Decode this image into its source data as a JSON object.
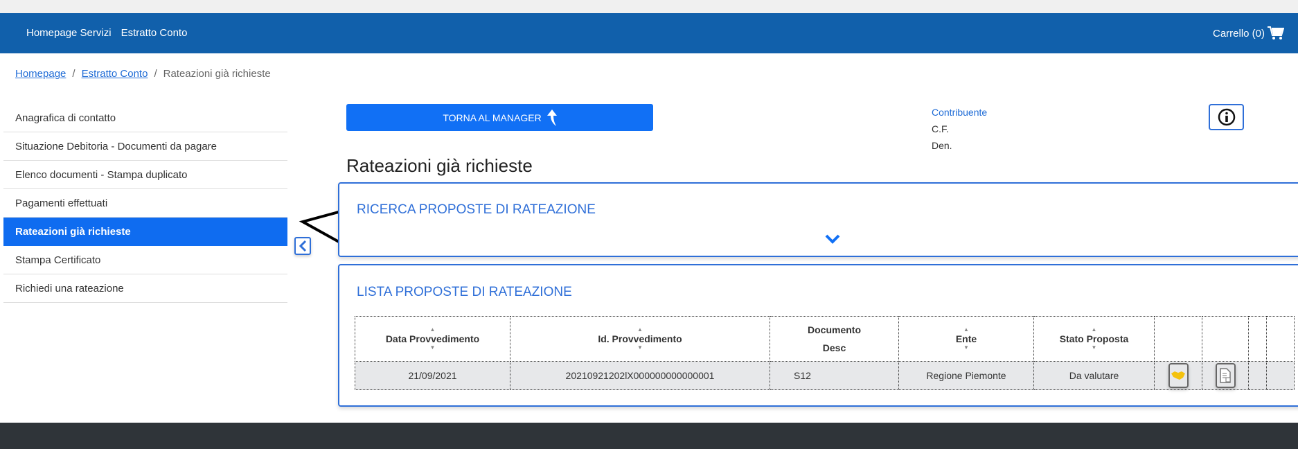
{
  "header": {
    "nav": [
      "Homepage Servizi",
      "Estratto Conto"
    ],
    "cart_label": "Carrello (0)"
  },
  "breadcrumb": {
    "items": [
      "Homepage",
      "Estratto Conto"
    ],
    "current": "Rateazioni già richieste"
  },
  "sidebar": {
    "items": [
      "Anagrafica di contatto",
      "Situazione Debitoria - Documenti da pagare",
      "Elenco documenti - Stampa duplicato",
      "Pagamenti effettuati",
      "Rateazioni già richieste",
      "Stampa Certificato",
      "Richiedi una rateazione"
    ],
    "active": "Rateazioni già richieste"
  },
  "torna_label": "TORNA AL MANAGER",
  "contribuente": {
    "label": "Contribuente",
    "cf": "C.F.",
    "den": "Den."
  },
  "page_title": "Rateazioni già richieste",
  "search_panel": {
    "title": "RICERCA PROPOSTE DI RATEAZIONE"
  },
  "list_panel": {
    "title": "LISTA PROPOSTE DI RATEAZIONE",
    "columns": [
      "Data Provvedimento",
      "Id. Provvedimento",
      "Documento",
      "Desc",
      "Ente",
      "Stato Proposta"
    ],
    "rows": [
      {
        "data": "21/09/2021",
        "id": "20210921202lX000000000000001",
        "doc": "S12",
        "ente": "Regione Piemonte",
        "stato": "Da valutare"
      }
    ]
  },
  "colors": {
    "header": "#1160ab",
    "accent": "#0f6cf0",
    "panel_border": "#2f6fd8",
    "footer": "#2f3439"
  }
}
